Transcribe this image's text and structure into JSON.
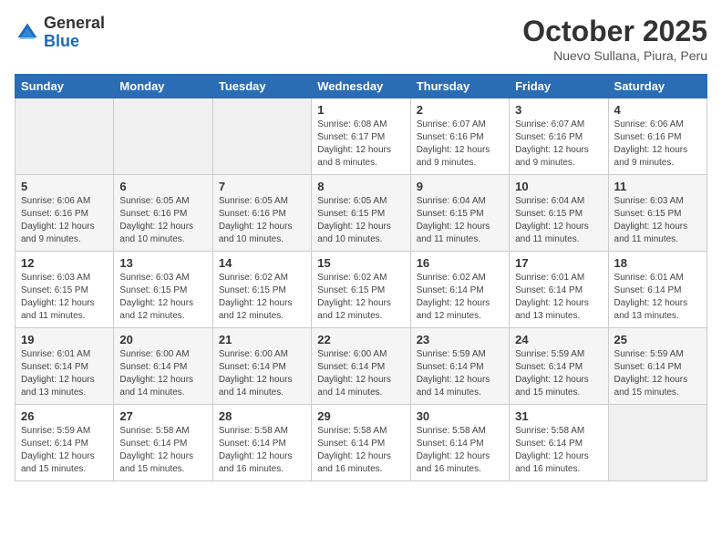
{
  "header": {
    "logo_general": "General",
    "logo_blue": "Blue",
    "month": "October 2025",
    "location": "Nuevo  Sullana, Piura, Peru"
  },
  "weekdays": [
    "Sunday",
    "Monday",
    "Tuesday",
    "Wednesday",
    "Thursday",
    "Friday",
    "Saturday"
  ],
  "weeks": [
    [
      {
        "day": "",
        "sunrise": "",
        "sunset": "",
        "daylight": ""
      },
      {
        "day": "",
        "sunrise": "",
        "sunset": "",
        "daylight": ""
      },
      {
        "day": "",
        "sunrise": "",
        "sunset": "",
        "daylight": ""
      },
      {
        "day": "1",
        "sunrise": "Sunrise: 6:08 AM",
        "sunset": "Sunset: 6:17 PM",
        "daylight": "Daylight: 12 hours and 8 minutes."
      },
      {
        "day": "2",
        "sunrise": "Sunrise: 6:07 AM",
        "sunset": "Sunset: 6:16 PM",
        "daylight": "Daylight: 12 hours and 9 minutes."
      },
      {
        "day": "3",
        "sunrise": "Sunrise: 6:07 AM",
        "sunset": "Sunset: 6:16 PM",
        "daylight": "Daylight: 12 hours and 9 minutes."
      },
      {
        "day": "4",
        "sunrise": "Sunrise: 6:06 AM",
        "sunset": "Sunset: 6:16 PM",
        "daylight": "Daylight: 12 hours and 9 minutes."
      }
    ],
    [
      {
        "day": "5",
        "sunrise": "Sunrise: 6:06 AM",
        "sunset": "Sunset: 6:16 PM",
        "daylight": "Daylight: 12 hours and 9 minutes."
      },
      {
        "day": "6",
        "sunrise": "Sunrise: 6:05 AM",
        "sunset": "Sunset: 6:16 PM",
        "daylight": "Daylight: 12 hours and 10 minutes."
      },
      {
        "day": "7",
        "sunrise": "Sunrise: 6:05 AM",
        "sunset": "Sunset: 6:16 PM",
        "daylight": "Daylight: 12 hours and 10 minutes."
      },
      {
        "day": "8",
        "sunrise": "Sunrise: 6:05 AM",
        "sunset": "Sunset: 6:15 PM",
        "daylight": "Daylight: 12 hours and 10 minutes."
      },
      {
        "day": "9",
        "sunrise": "Sunrise: 6:04 AM",
        "sunset": "Sunset: 6:15 PM",
        "daylight": "Daylight: 12 hours and 11 minutes."
      },
      {
        "day": "10",
        "sunrise": "Sunrise: 6:04 AM",
        "sunset": "Sunset: 6:15 PM",
        "daylight": "Daylight: 12 hours and 11 minutes."
      },
      {
        "day": "11",
        "sunrise": "Sunrise: 6:03 AM",
        "sunset": "Sunset: 6:15 PM",
        "daylight": "Daylight: 12 hours and 11 minutes."
      }
    ],
    [
      {
        "day": "12",
        "sunrise": "Sunrise: 6:03 AM",
        "sunset": "Sunset: 6:15 PM",
        "daylight": "Daylight: 12 hours and 11 minutes."
      },
      {
        "day": "13",
        "sunrise": "Sunrise: 6:03 AM",
        "sunset": "Sunset: 6:15 PM",
        "daylight": "Daylight: 12 hours and 12 minutes."
      },
      {
        "day": "14",
        "sunrise": "Sunrise: 6:02 AM",
        "sunset": "Sunset: 6:15 PM",
        "daylight": "Daylight: 12 hours and 12 minutes."
      },
      {
        "day": "15",
        "sunrise": "Sunrise: 6:02 AM",
        "sunset": "Sunset: 6:15 PM",
        "daylight": "Daylight: 12 hours and 12 minutes."
      },
      {
        "day": "16",
        "sunrise": "Sunrise: 6:02 AM",
        "sunset": "Sunset: 6:14 PM",
        "daylight": "Daylight: 12 hours and 12 minutes."
      },
      {
        "day": "17",
        "sunrise": "Sunrise: 6:01 AM",
        "sunset": "Sunset: 6:14 PM",
        "daylight": "Daylight: 12 hours and 13 minutes."
      },
      {
        "day": "18",
        "sunrise": "Sunrise: 6:01 AM",
        "sunset": "Sunset: 6:14 PM",
        "daylight": "Daylight: 12 hours and 13 minutes."
      }
    ],
    [
      {
        "day": "19",
        "sunrise": "Sunrise: 6:01 AM",
        "sunset": "Sunset: 6:14 PM",
        "daylight": "Daylight: 12 hours and 13 minutes."
      },
      {
        "day": "20",
        "sunrise": "Sunrise: 6:00 AM",
        "sunset": "Sunset: 6:14 PM",
        "daylight": "Daylight: 12 hours and 14 minutes."
      },
      {
        "day": "21",
        "sunrise": "Sunrise: 6:00 AM",
        "sunset": "Sunset: 6:14 PM",
        "daylight": "Daylight: 12 hours and 14 minutes."
      },
      {
        "day": "22",
        "sunrise": "Sunrise: 6:00 AM",
        "sunset": "Sunset: 6:14 PM",
        "daylight": "Daylight: 12 hours and 14 minutes."
      },
      {
        "day": "23",
        "sunrise": "Sunrise: 5:59 AM",
        "sunset": "Sunset: 6:14 PM",
        "daylight": "Daylight: 12 hours and 14 minutes."
      },
      {
        "day": "24",
        "sunrise": "Sunrise: 5:59 AM",
        "sunset": "Sunset: 6:14 PM",
        "daylight": "Daylight: 12 hours and 15 minutes."
      },
      {
        "day": "25",
        "sunrise": "Sunrise: 5:59 AM",
        "sunset": "Sunset: 6:14 PM",
        "daylight": "Daylight: 12 hours and 15 minutes."
      }
    ],
    [
      {
        "day": "26",
        "sunrise": "Sunrise: 5:59 AM",
        "sunset": "Sunset: 6:14 PM",
        "daylight": "Daylight: 12 hours and 15 minutes."
      },
      {
        "day": "27",
        "sunrise": "Sunrise: 5:58 AM",
        "sunset": "Sunset: 6:14 PM",
        "daylight": "Daylight: 12 hours and 15 minutes."
      },
      {
        "day": "28",
        "sunrise": "Sunrise: 5:58 AM",
        "sunset": "Sunset: 6:14 PM",
        "daylight": "Daylight: 12 hours and 16 minutes."
      },
      {
        "day": "29",
        "sunrise": "Sunrise: 5:58 AM",
        "sunset": "Sunset: 6:14 PM",
        "daylight": "Daylight: 12 hours and 16 minutes."
      },
      {
        "day": "30",
        "sunrise": "Sunrise: 5:58 AM",
        "sunset": "Sunset: 6:14 PM",
        "daylight": "Daylight: 12 hours and 16 minutes."
      },
      {
        "day": "31",
        "sunrise": "Sunrise: 5:58 AM",
        "sunset": "Sunset: 6:14 PM",
        "daylight": "Daylight: 12 hours and 16 minutes."
      },
      {
        "day": "",
        "sunrise": "",
        "sunset": "",
        "daylight": ""
      }
    ]
  ]
}
